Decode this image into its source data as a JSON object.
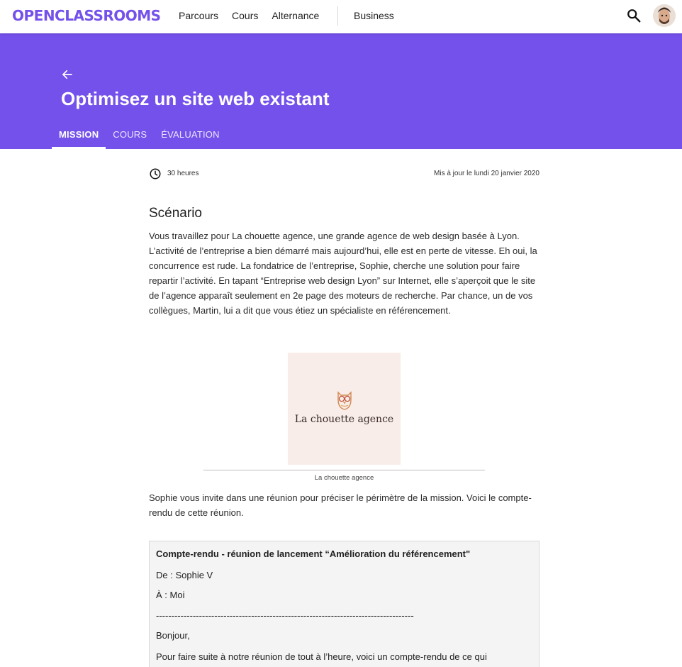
{
  "nav": {
    "logo": "OPENCLASSROOMS",
    "links": [
      "Parcours",
      "Cours",
      "Alternance"
    ],
    "business": "Business",
    "search_icon": "search-icon",
    "avatar_icon": "user-avatar"
  },
  "banner": {
    "color": "#7451eb",
    "back_icon": "arrow-left-icon",
    "title": "Optimisez un site web existant",
    "tabs": [
      "MISSION",
      "COURS",
      "ÉVALUATION"
    ],
    "active_tab": "MISSION"
  },
  "meta": {
    "duration": "30 heures",
    "updated": "Mis à jour le lundi 20 janvier 2020"
  },
  "scenario": {
    "title": "Scénario",
    "paragraph": "Vous travaillez pour La chouette agence, une grande agence de web design basée à Lyon. L’activité de l’entreprise a bien démarré mais aujourd’hui, elle est en perte de vitesse. Eh oui, la concurrence est rude. La fondatrice de l’entreprise, Sophie, cherche une solution pour faire repartir l’activité. En tapant “Entreprise web design Lyon” sur Internet, elle s’aperçoit que le site de l’agence apparaît seulement en 2e page des moteurs de recherche. Par chance, un de vos collègues, Martin, lui a dit que vous étiez un spécialiste en référencement.",
    "image_text": "La chouette agence",
    "caption": "La chouette agence",
    "paragraph2": "Sophie vous invite dans une réunion pour préciser le périmètre de la mission. Voici le compte-rendu de cette réunion."
  },
  "report": {
    "title": "Compte-rendu - réunion de lancement “Amélioration du référencement\"",
    "from": "De : Sophie V",
    "to": "À : Moi",
    "separator": "------------------------------------------------------------------------------------",
    "greeting": "Bonjour,",
    "body": "Pour faire suite à notre réunion de tout à l’heure, voici un compte-rendu de ce qui"
  }
}
